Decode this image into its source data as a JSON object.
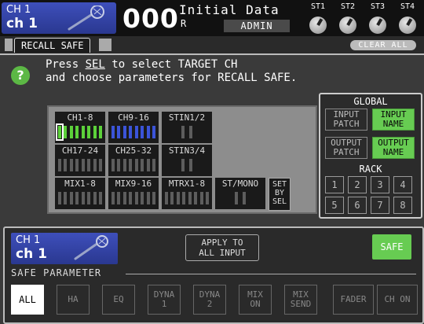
{
  "header": {
    "channel_num": "CH 1",
    "channel_name": "ch 1",
    "scene_number": "000",
    "scene_title": "Initial Data",
    "read_only_flag": "R",
    "user": "ADMIN",
    "st_knobs": [
      "ST1",
      "ST2",
      "ST3",
      "ST4"
    ]
  },
  "tabs": {
    "active": "RECALL SAFE",
    "clear_all": "CLEAR ALL"
  },
  "message": {
    "line1_pre": "Press ",
    "line1_sel": "SEL",
    "line1_post": " to select TARGET CH",
    "line2": "and choose parameters for RECALL SAFE."
  },
  "matrix": {
    "cells": [
      "CH1-8",
      "CH9-16",
      "STIN1/2",
      "CH17-24",
      "CH25-32",
      "STIN3/4",
      "MIX1-8",
      "MIX9-16",
      "MTRX1-8",
      "ST/MONO"
    ],
    "set_by_sel": [
      "SET",
      "BY",
      "SEL"
    ],
    "colors": {
      "ch1_8": "#5cd13a",
      "ch9_16": "#3b54d8",
      "off": "#5d5d5d"
    }
  },
  "global": {
    "title": "GLOBAL",
    "input_patch": [
      "INPUT",
      "PATCH"
    ],
    "input_name": [
      "INPUT",
      "NAME"
    ],
    "output_patch": [
      "OUTPUT",
      "PATCH"
    ],
    "output_name": [
      "OUTPUT",
      "NAME"
    ],
    "rack_title": "RACK",
    "rack": [
      "1",
      "2",
      "3",
      "4",
      "5",
      "6",
      "7",
      "8"
    ]
  },
  "bottom": {
    "channel_num": "CH 1",
    "channel_name": "ch 1",
    "apply": [
      "APPLY TO",
      "ALL INPUT"
    ],
    "safe": "SAFE",
    "section_label": "SAFE PARAMETER",
    "params": [
      [
        "ALL"
      ],
      [
        "HA"
      ],
      [
        "EQ"
      ],
      [
        "DYNA",
        "1"
      ],
      [
        "DYNA",
        "2"
      ],
      [
        "MIX",
        "ON"
      ],
      [
        "MIX",
        "SEND"
      ],
      [
        "FADER"
      ],
      [
        "CH ON"
      ]
    ]
  }
}
